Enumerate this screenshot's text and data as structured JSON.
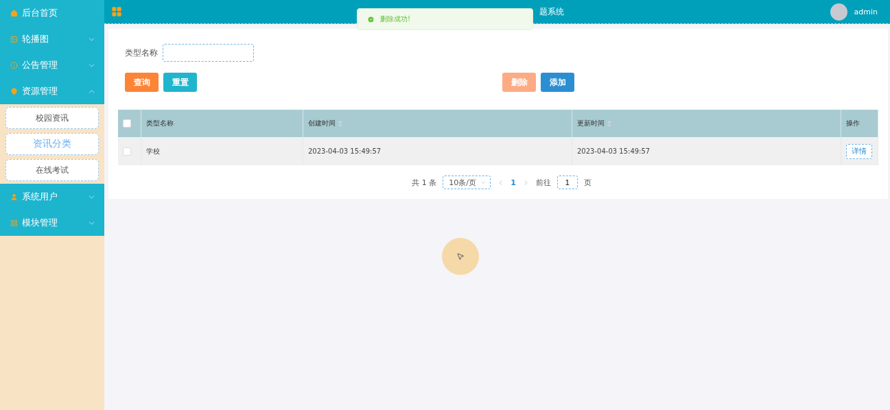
{
  "sidebar": {
    "items": [
      {
        "label": "后台首页",
        "has_caret": false
      },
      {
        "label": "轮播图",
        "expanded": false,
        "has_caret": true
      },
      {
        "label": "公告管理",
        "expanded": false,
        "has_caret": true
      },
      {
        "label": "资源管理",
        "expanded": true,
        "has_caret": true,
        "children": [
          {
            "label": "校园资讯",
            "selected": false
          },
          {
            "label": "资讯分类",
            "selected": true
          },
          {
            "label": "在线考试",
            "selected": false
          }
        ]
      },
      {
        "label": "系统用户",
        "expanded": false,
        "has_caret": true
      },
      {
        "label": "模块管理",
        "expanded": false,
        "has_caret": true
      }
    ]
  },
  "header": {
    "title": "题系统",
    "user": "admin"
  },
  "toast": {
    "message": "删除成功!"
  },
  "search": {
    "label": "类型名称"
  },
  "buttons": [
    {
      "label": "查询",
      "kind": "query"
    },
    {
      "label": "重置",
      "kind": "reset"
    },
    {
      "label": "删除",
      "kind": "delete"
    },
    {
      "label": "添加",
      "kind": "add"
    }
  ],
  "table": {
    "select_all_checked": false,
    "columns": [
      {
        "label": "类型名称",
        "sortable": false
      },
      {
        "label": "创建时间",
        "sortable": true
      },
      {
        "label": "更新时间",
        "sortable": true
      },
      {
        "label": "操作",
        "sortable": false
      }
    ],
    "rows": [
      {
        "checked": false,
        "cells": [
          "学校",
          "2023-04-03 15:49:57",
          "2023-04-03 15:49:57"
        ],
        "action": "详情"
      }
    ]
  },
  "pagination": {
    "total": "共 1 条",
    "page_size": "10条/页",
    "current": "1",
    "goto_label": "前往",
    "goto_value": "1",
    "goto_suffix": "页"
  }
}
